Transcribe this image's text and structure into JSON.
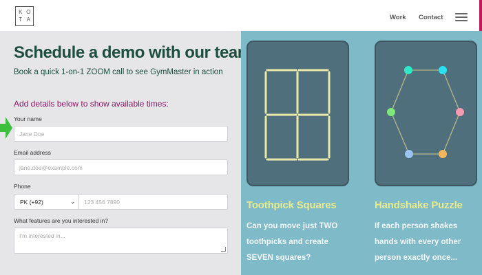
{
  "header": {
    "logo_letters": [
      "K",
      "O",
      "T",
      "A"
    ],
    "nav": {
      "work": "Work",
      "contact": "Contact"
    }
  },
  "form": {
    "title": "Schedule a demo with our team",
    "subtitle": "Book a quick 1-on-1 ZOOM call to see GymMaster in action",
    "hint": "Add details below to show available times:",
    "name_label": "Your name",
    "name_placeholder": "Jane Doe",
    "email_label": "Email address",
    "email_placeholder": "jane.doe@example.com",
    "phone_label": "Phone",
    "phone_country": "PK (+92)",
    "phone_placeholder": "123 456 7890",
    "features_label": "What features are you interested in?",
    "features_placeholder": "I'm interested in..."
  },
  "puzzles": [
    {
      "title": "Toothpick Squares",
      "description": "Can you move just TWO toothpicks and create SEVEN squares?"
    },
    {
      "title": "Handshake Puzzle",
      "description": "If each person shakes hands with every other person exactly once..."
    }
  ],
  "colors": {
    "title_green": "#1d4e3e",
    "hint_magenta": "#8e1a66",
    "right_bg": "#7fbac8",
    "card_bg": "#4f6f7d",
    "puzzle_title_yellow": "#e8ea8c",
    "arrow_green": "#3cbf3c",
    "toothpick": "#e9e8a8"
  }
}
